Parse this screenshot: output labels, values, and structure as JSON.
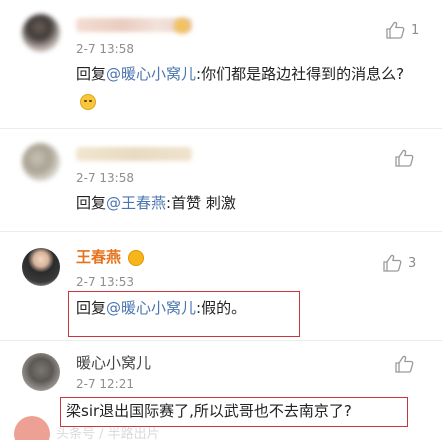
{
  "comments": [
    {
      "author": "",
      "time": "2-7 13:58",
      "reply_prefix": "回复",
      "mention": "@暖心小窝儿",
      "reply_text": ":你们都是路边社得到的消息么?",
      "emoji_icon": "smile-emoji-icon",
      "like_icon": "thumbs-up-icon",
      "like_count": "1"
    },
    {
      "author": "",
      "time": "2-7 13:58",
      "reply_prefix": "回复",
      "mention": "@王春燕",
      "reply_text": ":首赞 刺激",
      "like_icon": "thumbs-up-icon",
      "like_count": ""
    },
    {
      "author": "王春燕",
      "time": "2-7 13:53",
      "reply_prefix": "回复",
      "mention": "@暖心小窝儿",
      "reply_text": ":假的。",
      "like_icon": "thumbs-up-icon",
      "like_count": "3"
    },
    {
      "author": "暖心小窝儿",
      "time": "2-7 12:21",
      "reply_text": "梁sir退出国际赛了,所以武哥也不去南京了?",
      "like_icon": "thumbs-up-icon",
      "like_count": ""
    }
  ],
  "watermark": "头条号 / 半路出片",
  "colors": {
    "mention": "#4a75b2",
    "author_highlight": "#e8721c",
    "highlight_box": "#c8363e",
    "meta_text": "#8e8e8e"
  }
}
